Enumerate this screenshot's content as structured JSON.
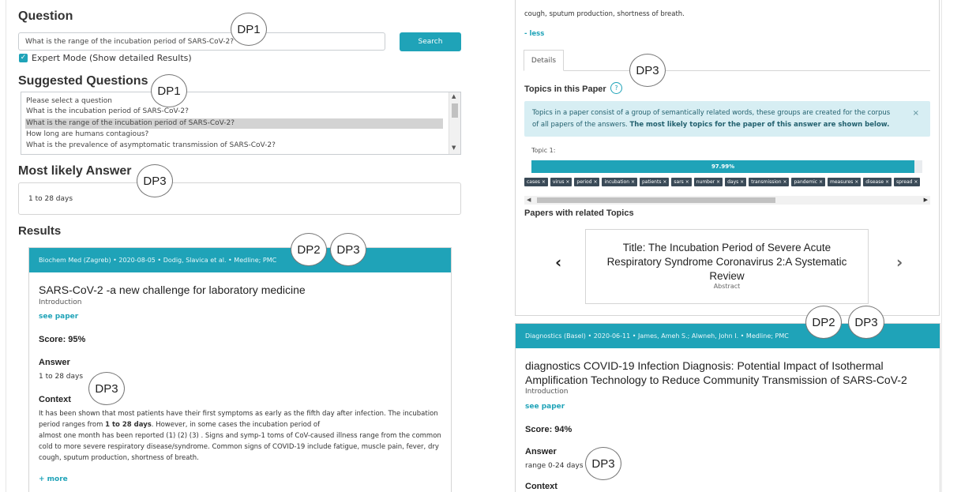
{
  "question": {
    "title": "Question",
    "input_value": "What is the range of the incubation period of SARS-CoV-2?",
    "search_label": "Search",
    "expert_mode_label": "Expert Mode (Show detailed Results)"
  },
  "suggested": {
    "title": "Suggested Questions",
    "options": [
      "Please select a question",
      "What is the incubation period of SARS-CoV-2?",
      "What is the range of the incubation period of SARS-CoV-2?",
      "How long are humans contagious?",
      "What is the prevalence of asymptomatic transmission of SARS-CoV-2?"
    ],
    "selected_index": 2
  },
  "answer": {
    "title": "Most likely Answer",
    "value": "1 to 28 days"
  },
  "results": {
    "title": "Results",
    "cards": [
      {
        "header": "Biochem Med (Zagreb) • 2020-08-05 • Dodig, Slavica et al. • Medline; PMC",
        "title": "SARS-CoV-2 -a new challenge for laboratory medicine",
        "section": "Introduction",
        "link": "see paper",
        "score": "Score: 95%",
        "answer_label": "Answer",
        "answer": "1 to 28 days",
        "context_label": "Context",
        "context_lines": [
          "It has been shown that most patients have their first symptoms as early as the fifth day after infection. The incubation",
          "period ranges from",
          "1 to 28 days",
          ". However, in some cases the incubation period of",
          "almost one month has been reported (1) (2) (3) . Signs and symp-1 toms of CoV-caused illness range from the common",
          "cold to more severe respiratory disease/syndrome. Common signs of COVID-19 include fatigue, muscle pain, fever, dry",
          "cough, sputum production, shortness of breath."
        ],
        "more": "+ more"
      },
      {
        "header": "Diagnostics (Basel) • 2020-06-11 • James, Ameh S.; Alwneh, John I. • Medline; PMC",
        "title_lines": [
          "diagnostics COVID-19 Infection Diagnosis: Potential Impact of Isothermal",
          "Amplification Technology to Reduce Community Transmission of SARS-CoV-2"
        ],
        "section": "Introduction",
        "link": "see paper",
        "score": "Score: 94%",
        "answer_label": "Answer",
        "answer": "range 0-24 days",
        "context_label": "Context"
      }
    ]
  },
  "right_panel": {
    "cut_text": "cough, sputum production, shortness of breath.",
    "less": "- less",
    "tab": "Details",
    "topics_title": "Topics in this Paper",
    "help": "?",
    "info_text": "Topics in a paper consist of a group of semantically related words, these groups are created for the corpus",
    "info_text2_a": "of all papers of the answers.",
    "info_text2_b": "The most likely topics for the paper of this answer are shown below.",
    "info_close": "×",
    "topic_label": "Topic 1:",
    "topic_percent": "97.99%",
    "topic_fraction": 0.9799,
    "tags": [
      "cases",
      "virus",
      "period",
      "incubation",
      "patients",
      "sars",
      "number",
      "days",
      "transmission",
      "pandemic",
      "measures",
      "disease",
      "spread"
    ],
    "papers_title": "Papers with related Topics",
    "carousel_title": "Title: The Incubation Period of Severe Acute Respiratory Syndrome Coronavirus 2:A Systematic Review",
    "carousel_sub": "Abstract",
    "prev": "‹",
    "next": "›"
  },
  "badges": {
    "dp1": "DP1",
    "dp2": "DP2",
    "dp3": "DP3"
  },
  "colors": {
    "accent": "#1fa3b8",
    "info_bg": "#d7eef3"
  }
}
